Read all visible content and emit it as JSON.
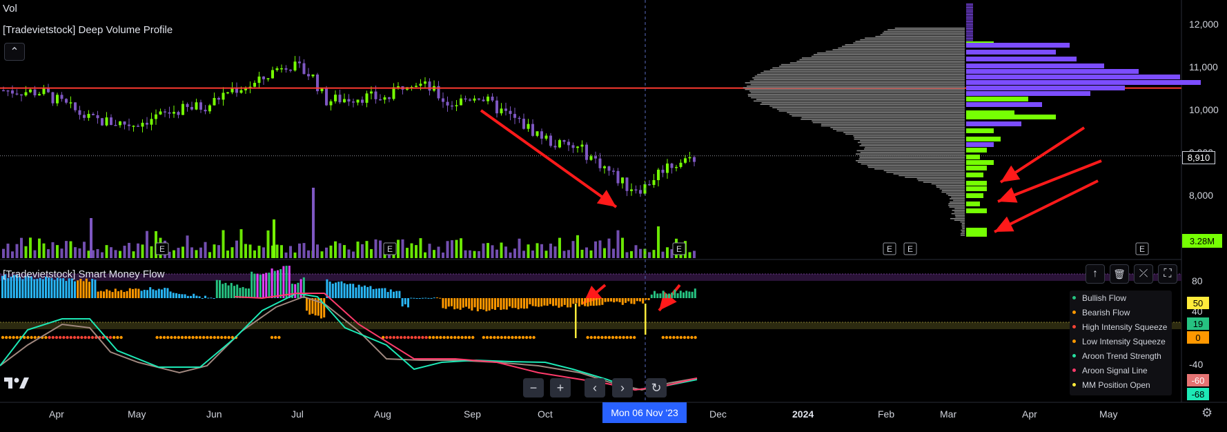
{
  "header": {
    "vol_label": "Vol",
    "indicator_title": "[Tradevietstock] Deep Volume Profile",
    "collapse_icon": "chevron-up-icon"
  },
  "price_axis": {
    "ticks": [
      "12,000",
      "11,000",
      "10,000",
      "9,000",
      "8,000"
    ],
    "last_price_label": "8,910",
    "volume_label": "3.28M"
  },
  "smf_panel": {
    "title": "[Tradevietstock] Smart Money Flow",
    "axis_ticks": [
      "80",
      "40",
      "-40"
    ],
    "value_badges": [
      {
        "text": "50",
        "color": "#ffeb3b"
      },
      {
        "text": "19",
        "color": "#26c281"
      },
      {
        "text": "0",
        "color": "#ff9800"
      },
      {
        "text": "-60",
        "color": "#e57373"
      },
      {
        "text": "-68",
        "color": "#1de9b6"
      }
    ],
    "legend": [
      {
        "label": "Bullish Flow",
        "color": "#26c281"
      },
      {
        "label": "Bearish Flow",
        "color": "#ff9800"
      },
      {
        "label": "High Intensity Squeeze",
        "color": "#f44336"
      },
      {
        "label": "Low Intensity Squeeze",
        "color": "#ff9800"
      },
      {
        "label": "Aroon Trend Strength",
        "color": "#26e0a0"
      },
      {
        "label": "Aroon Signal Line",
        "color": "#ff3b6b"
      },
      {
        "label": "MM Position Open",
        "color": "#ffeb3b"
      }
    ],
    "toolbar_icons": [
      "arrow-up-icon",
      "trash-icon",
      "collapse-icon",
      "maximize-icon"
    ]
  },
  "time_axis": {
    "labels": [
      "Apr",
      "May",
      "Jun",
      "Jul",
      "Aug",
      "Sep",
      "Oct",
      "Dec",
      "2024",
      "Feb",
      "Mar",
      "Apr",
      "May"
    ],
    "crosshair_date": "Mon 06 Nov '23"
  },
  "earnings_marker": "E",
  "nav_buttons": [
    "−",
    "+",
    "‹",
    "›",
    "↻"
  ],
  "colors": {
    "up": "#76ff03",
    "down": "#7e57c2",
    "resistance": "#ff3b30",
    "arrow": "#ff1a1a",
    "profile_gray": "#9e9e9e",
    "profile_purple": "#7c4dff",
    "profile_green": "#76ff03"
  },
  "chart_data": {
    "type": "candlestick",
    "x": [
      "Apr",
      "May",
      "Jun",
      "Jul",
      "Aug",
      "Sep",
      "Oct",
      "Nov",
      "Dec"
    ],
    "close_approx": [
      10400,
      9600,
      10100,
      11200,
      10300,
      10400,
      9500,
      8100,
      8910
    ],
    "resistance_level": 10500,
    "last_price": 8910,
    "ylim": [
      7400,
      12400
    ]
  }
}
